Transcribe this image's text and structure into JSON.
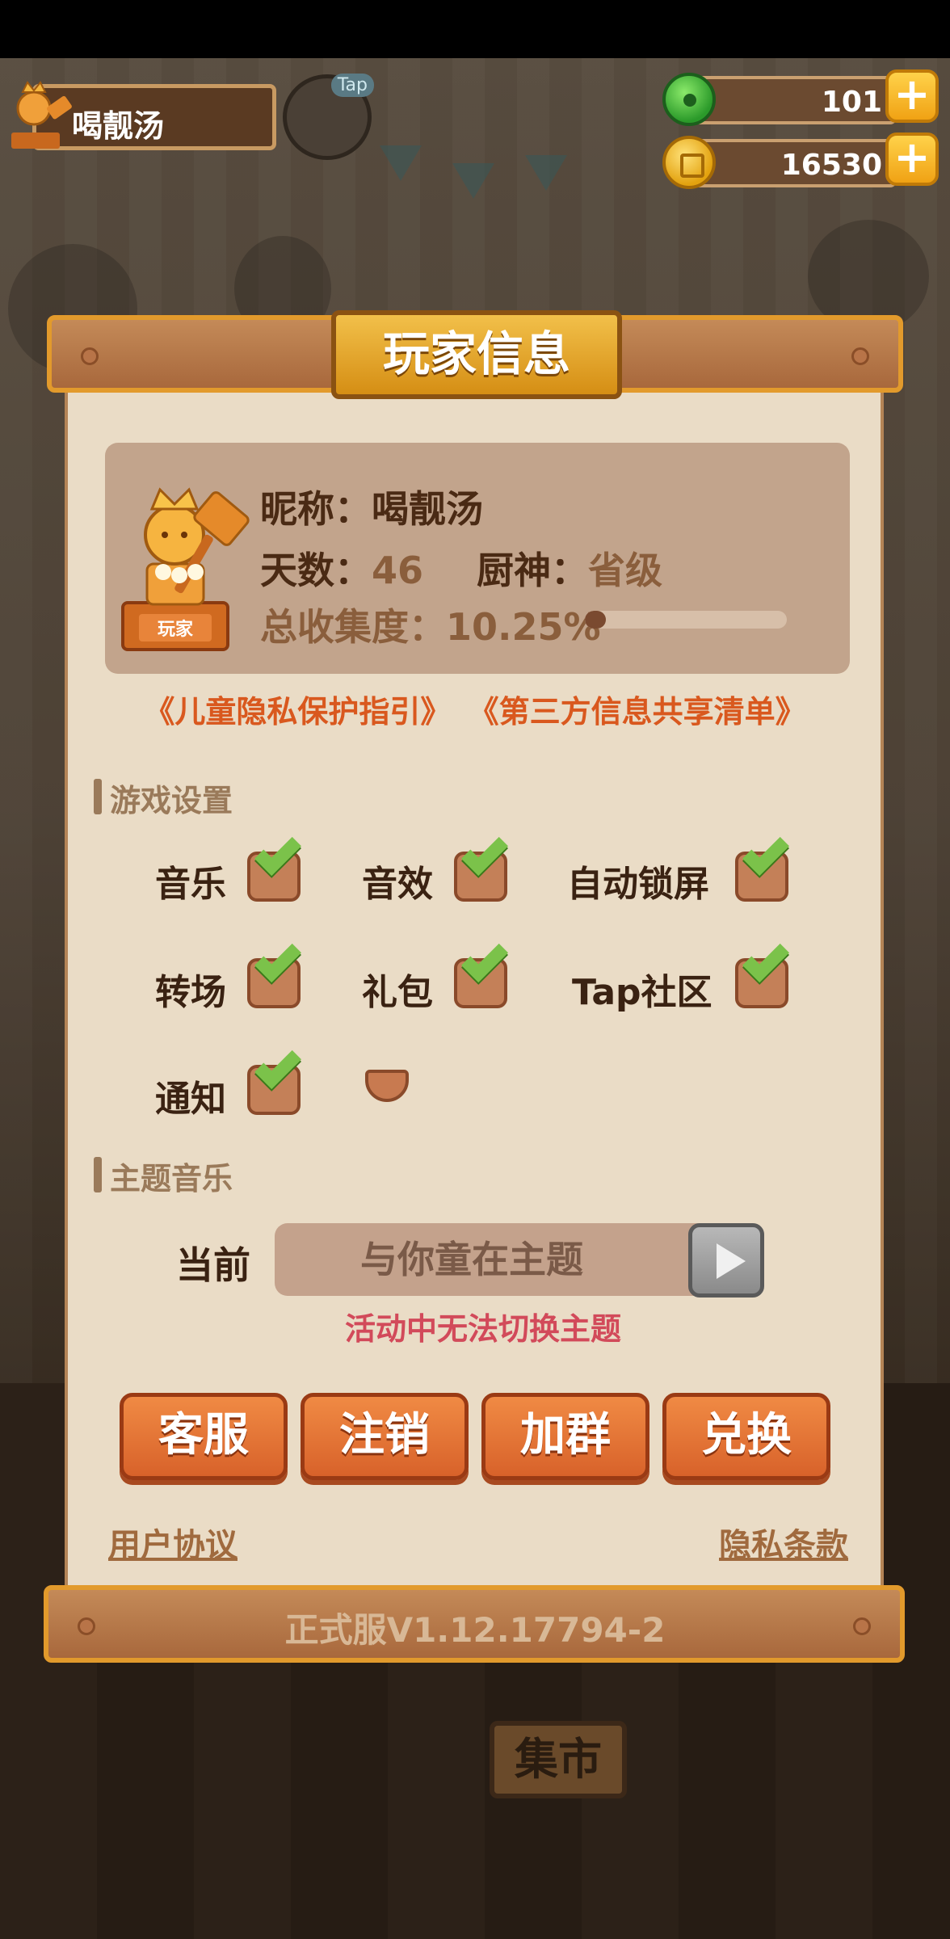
{
  "hud": {
    "player_name": "喝靓汤",
    "tap_label": "Tap",
    "gems": "101",
    "coins": "16530",
    "plus": "+"
  },
  "background": {
    "market_sign": "集市"
  },
  "dialog": {
    "title": "玩家信息",
    "trophy_label": "玩家",
    "nickname_label": "昵称：",
    "nickname": "喝靓汤",
    "days_label": "天数：",
    "days": "46",
    "chef_label": "厨神：",
    "chef_rank": "省级",
    "collection_label": "总收集度：",
    "collection": "10.25%",
    "collection_fraction": 0.1025,
    "link_child_privacy": "《儿童隐私保护指引》",
    "link_third_party": "《第三方信息共享清单》",
    "game_settings_title": "游戏设置",
    "settings": [
      {
        "label": "音乐",
        "checked": true
      },
      {
        "label": "音效",
        "checked": true
      },
      {
        "label": "自动锁屏",
        "checked": true
      },
      {
        "label": "转场",
        "checked": true
      },
      {
        "label": "礼包",
        "checked": true
      },
      {
        "label": "Tap社区",
        "checked": true
      },
      {
        "label": "通知",
        "checked": true
      }
    ],
    "theme_music_title": "主题音乐",
    "current_label": "当前",
    "current_theme": "与你童在主题",
    "theme_warning": "活动中无法切换主题",
    "buttons": {
      "service": "客服",
      "logout": "注销",
      "join_group": "加群",
      "redeem": "兑换"
    },
    "user_agreement": "用户协议",
    "privacy_terms": "隐私条款",
    "version": "正式服V1.12.17794-2"
  },
  "colors": {
    "accent_orange": "#d8622a",
    "link_orange": "#d9581e",
    "warning_red": "#d24a5a",
    "check_green": "#7bc24a"
  }
}
